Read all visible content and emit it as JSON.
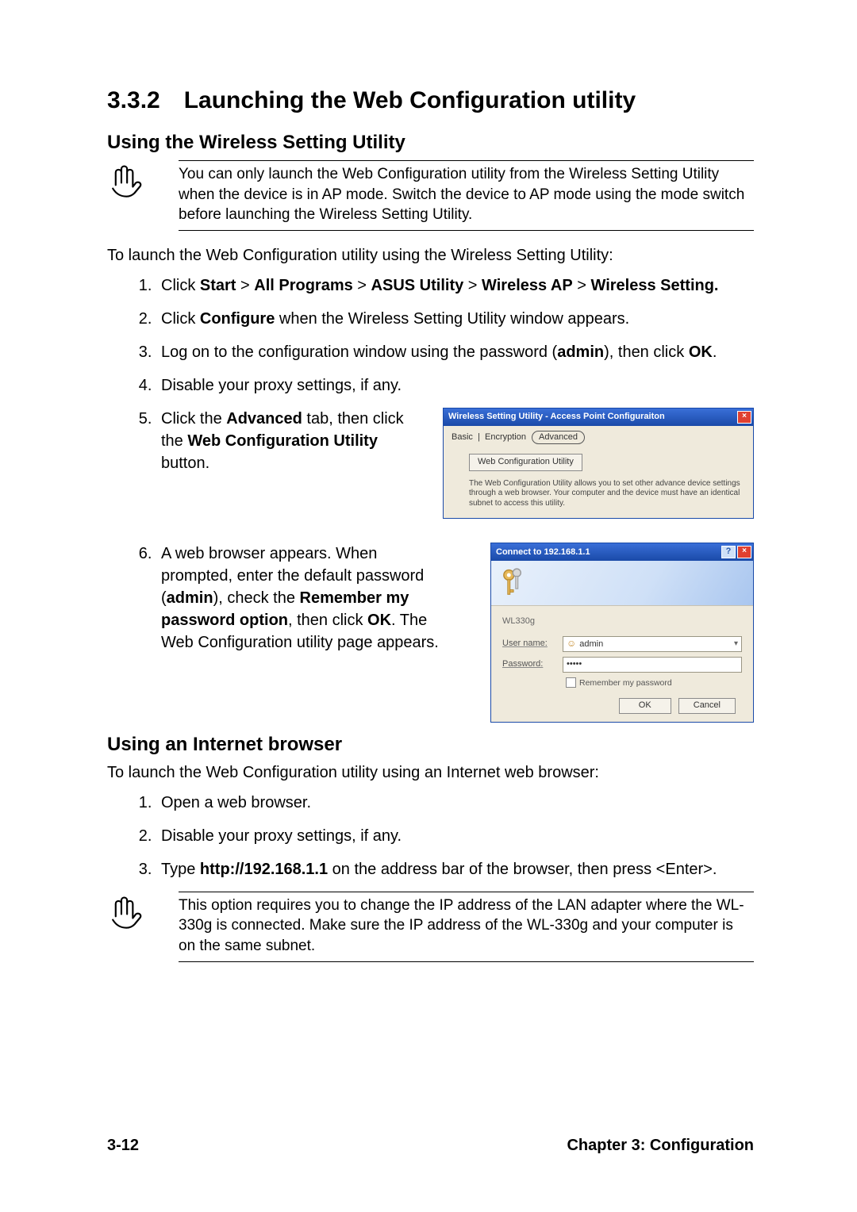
{
  "heading": "3.3.2 Launching the Web Configuration utility",
  "sub1": "Using the Wireless Setting Utility",
  "note1": "You can only launch the Web Configuration utility from the Wireless Setting Utility when the device is in AP mode. Switch the device to AP mode using the mode switch before launching the Wireless Setting Utility.",
  "intro1": "To launch the Web Configuration utility using the Wireless Setting Utility:",
  "steps_a": {
    "s1_pre": "Click ",
    "s1_b1": "Start",
    "s1_gt1": " > ",
    "s1_b2": "All Programs",
    "s1_gt2": " > ",
    "s1_b3": "ASUS Utility",
    "s1_gt3": " > ",
    "s1_b4": "Wireless AP",
    "s1_gt4": " > ",
    "s1_b5": "Wireless Setting.",
    "s2_pre": "Click ",
    "s2_b": "Configure",
    "s2_post": " when the Wireless Setting Utility window appears.",
    "s3_pre": "Log on to the configuration window using the password (",
    "s3_b1": "admin",
    "s3_mid": "), then click ",
    "s3_b2": "OK",
    "s3_post": ".",
    "s4": "Disable your proxy settings, if any.",
    "s5_pre": "Click the ",
    "s5_b1": "Advanced",
    "s5_mid": " tab, then click the ",
    "s5_b2": "Web Configuration Utility",
    "s5_post": " button.",
    "s6_pre": "A web browser appears. When prompted, enter the default password (",
    "s6_b1": "admin",
    "s6_mid1": "), check the ",
    "s6_b2": "Remember my password option",
    "s6_mid2": ", then click ",
    "s6_b3": "OK",
    "s6_post": ". The Web Configuration utility page appears."
  },
  "dialog1": {
    "title": "Wireless Setting Utility - Access Point Configuraiton",
    "tabs": {
      "t1": "Basic",
      "t2": "Encryption",
      "t3": "Advanced"
    },
    "button": "Web Configuration Utility",
    "desc": "The Web Configuration Utility allows you to set other advance device settings through a web browser. Your computer and the device must have an identical subnet to access this utility."
  },
  "dialog2": {
    "title": "Connect to 192.168.1.1",
    "realm": "WL330g",
    "user_label": "User name:",
    "pass_label": "Password:",
    "user_value": "admin",
    "pass_value": "•••••",
    "remember": "Remember my password",
    "ok": "OK",
    "cancel": "Cancel"
  },
  "sub2": "Using an Internet browser",
  "intro2": "To launch the Web Configuration utility using an Internet web browser:",
  "steps_b": {
    "s1": "Open a web browser.",
    "s2": "Disable your proxy settings, if any.",
    "s3_pre": "Type ",
    "s3_b": "http://192.168.1.1",
    "s3_post": " on the address bar of the browser, then press <Enter>."
  },
  "note2": "This option requires you to change the IP address of the LAN adapter where the WL-330g is connected. Make sure the IP address of the WL-330g and your computer is on the same subnet.",
  "footer_left": "3-12",
  "footer_right": "Chapter 3: Configuration"
}
